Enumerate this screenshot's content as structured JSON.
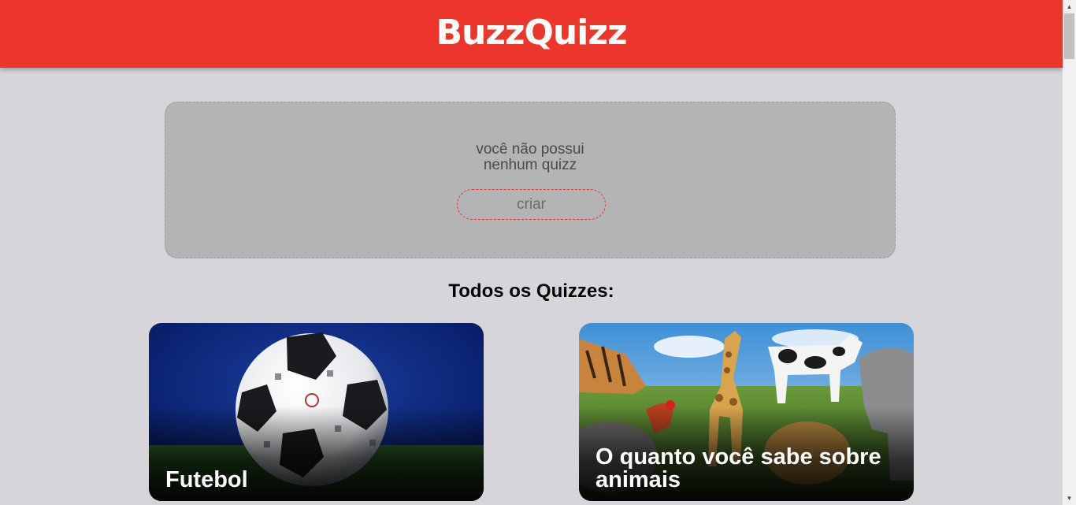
{
  "header": {
    "logo": "BuzzQuizz"
  },
  "user_quizzes": {
    "empty_line1": "você não possui",
    "empty_line2": "nenhum quizz",
    "create_label": "criar"
  },
  "all_quizzes": {
    "title": "Todos os Quizzes:",
    "items": [
      {
        "title": "Futebol",
        "image": "soccer-ball-image"
      },
      {
        "title": "O quanto você sabe sobre animais",
        "image": "animals-image"
      }
    ]
  },
  "colors": {
    "brand_red": "#ec362d",
    "background": "#d6d5da",
    "empty_box": "#b4b4b6"
  }
}
